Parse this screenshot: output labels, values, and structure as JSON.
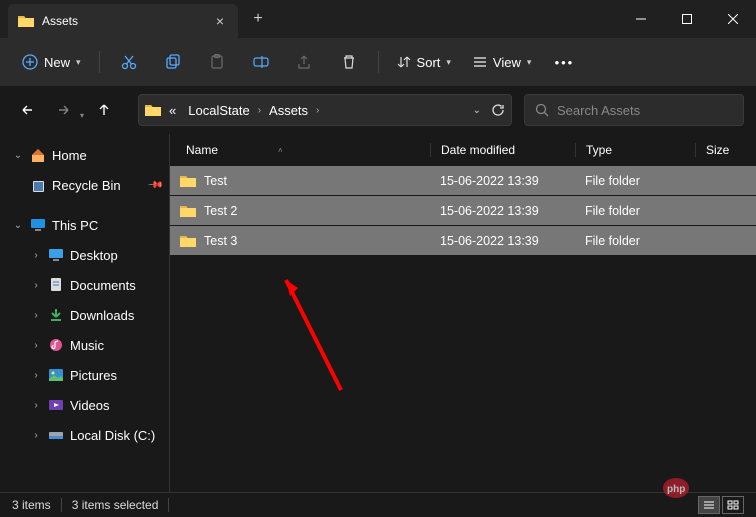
{
  "window": {
    "tab_title": "Assets",
    "newtab_label": "+",
    "close_label": "×"
  },
  "toolbar": {
    "new_label": "New",
    "sort_label": "Sort",
    "view_label": "View"
  },
  "breadcrumbs": {
    "ellipsis": "«",
    "crumb1": "LocalState",
    "crumb2": "Assets"
  },
  "search": {
    "placeholder": "Search Assets"
  },
  "sidebar": {
    "home": "Home",
    "recycle": "Recycle Bin",
    "thispc": "This PC",
    "desktop": "Desktop",
    "documents": "Documents",
    "downloads": "Downloads",
    "music": "Music",
    "pictures": "Pictures",
    "videos": "Videos",
    "localdisk": "Local Disk (C:)"
  },
  "columns": {
    "name": "Name",
    "date": "Date modified",
    "type": "Type",
    "size": "Size"
  },
  "rows": [
    {
      "name": "Test",
      "date": "15-06-2022 13:39",
      "type": "File folder"
    },
    {
      "name": "Test 2",
      "date": "15-06-2022 13:39",
      "type": "File folder"
    },
    {
      "name": "Test 3",
      "date": "15-06-2022 13:39",
      "type": "File folder"
    }
  ],
  "status": {
    "items": "3 items",
    "selected": "3 items selected"
  }
}
